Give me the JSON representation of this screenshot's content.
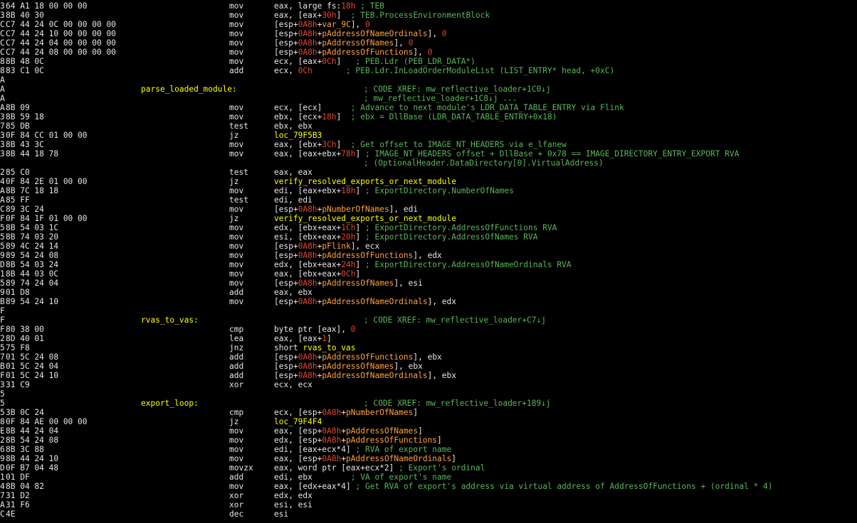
{
  "colors": {
    "background": "#000000",
    "text": "#e6e6e6",
    "number": "#e0472c",
    "variable": "#ffa13d",
    "comment": "#5ab55a",
    "label": "#ffff00"
  },
  "lines": [
    {
      "prefix": "3",
      "bytes": "64 A1 18 00 00 00",
      "mnemonic": "mov",
      "operands": [
        [
          "t",
          "eax, large fs:"
        ],
        [
          "n",
          "18h"
        ],
        [
          "c",
          " ; TEB"
        ]
      ]
    },
    {
      "prefix": "3",
      "bytes": "8B 40 30",
      "mnemonic": "mov",
      "operands": [
        [
          "t",
          "eax, [eax+"
        ],
        [
          "n",
          "30h"
        ],
        [
          "t",
          "]"
        ],
        [
          "c",
          "  ; TEB.ProcessEnvironmentBlock"
        ]
      ]
    },
    {
      "prefix": "C",
      "bytes": "C7 44 24 0C 00 00 00 00",
      "mnemonic": "mov",
      "operands": [
        [
          "t",
          "[esp+"
        ],
        [
          "n",
          "0A8h"
        ],
        [
          "t",
          "+"
        ],
        [
          "v",
          "var_9C"
        ],
        [
          "t",
          "], "
        ],
        [
          "n",
          "0"
        ]
      ]
    },
    {
      "prefix": "C",
      "bytes": "C7 44 24 10 00 00 00 00",
      "mnemonic": "mov",
      "operands": [
        [
          "t",
          "[esp+"
        ],
        [
          "n",
          "0A8h"
        ],
        [
          "t",
          "+"
        ],
        [
          "v",
          "pAddressOfNameOrdinals"
        ],
        [
          "t",
          "], "
        ],
        [
          "n",
          "0"
        ]
      ]
    },
    {
      "prefix": "C",
      "bytes": "C7 44 24 04 00 00 00 00",
      "mnemonic": "mov",
      "operands": [
        [
          "t",
          "[esp+"
        ],
        [
          "n",
          "0A8h"
        ],
        [
          "t",
          "+"
        ],
        [
          "v",
          "pAddressOfNames"
        ],
        [
          "t",
          "], "
        ],
        [
          "n",
          "0"
        ]
      ]
    },
    {
      "prefix": "C",
      "bytes": "C7 44 24 08 00 00 00 00",
      "mnemonic": "mov",
      "operands": [
        [
          "t",
          "[esp+"
        ],
        [
          "n",
          "0A8h"
        ],
        [
          "t",
          "+"
        ],
        [
          "v",
          "pAddressOfFunctions"
        ],
        [
          "t",
          "], "
        ],
        [
          "n",
          "0"
        ]
      ]
    },
    {
      "prefix": "8",
      "bytes": "8B 48 0C",
      "mnemonic": "mov",
      "operands": [
        [
          "t",
          "ecx, [eax+"
        ],
        [
          "n",
          "0Ch"
        ],
        [
          "t",
          "]"
        ],
        [
          "c",
          "   ; PEB.Ldr (PEB_LDR_DATA*)"
        ]
      ]
    },
    {
      "prefix": "8",
      "bytes": "83 C1 0C",
      "mnemonic": "add",
      "operands": [
        [
          "t",
          "ecx, "
        ],
        [
          "n",
          "0Ch"
        ],
        [
          "c",
          "       ; PEB.Ldr.InLoadOrderModuleList (LIST_ENTRY* head, +0xC)"
        ]
      ]
    },
    {
      "prefix": "A"
    },
    {
      "prefix": "A",
      "label": "parse_loaded_module:",
      "xref": "; CODE XREF: mw_reflective_loader+1C0↓j"
    },
    {
      "prefix": "A",
      "xref": "; mw_reflective_loader+1C8↓j ..."
    },
    {
      "prefix": "A",
      "bytes": "8B 09",
      "mnemonic": "mov",
      "operands": [
        [
          "t",
          "ecx, [ecx]"
        ],
        [
          "c",
          "      ; Advance to next module's LDR_DATA_TABLE_ENTRY via Flink"
        ]
      ]
    },
    {
      "prefix": "3",
      "bytes": "8B 59 18",
      "mnemonic": "mov",
      "operands": [
        [
          "t",
          "ebx, [ecx+"
        ],
        [
          "n",
          "18h"
        ],
        [
          "t",
          "]"
        ],
        [
          "c",
          "  ; ebx = DllBase (LDR_DATA_TABLE_ENTRY+0x18)"
        ]
      ]
    },
    {
      "prefix": "7",
      "bytes": "85 DB",
      "mnemonic": "test",
      "operands": [
        [
          "t",
          "ebx, ebx"
        ]
      ]
    },
    {
      "prefix": "3",
      "bytes": "0F 84 CC 01 00 00",
      "mnemonic": "jz",
      "operands": [
        [
          "y",
          "loc_79F5B3"
        ]
      ]
    },
    {
      "prefix": "3",
      "bytes": "8B 43 3C",
      "mnemonic": "mov",
      "operands": [
        [
          "t",
          "eax, [ebx+"
        ],
        [
          "n",
          "3Ch"
        ],
        [
          "t",
          "]"
        ],
        [
          "c",
          "  ; Get offset to IMAGE_NT_HEADERS via e_lfanew"
        ]
      ]
    },
    {
      "prefix": "3",
      "bytes": "8B 44 18 78",
      "mnemonic": "mov",
      "operands": [
        [
          "t",
          "eax, [eax+ebx+"
        ],
        [
          "n",
          "78h"
        ],
        [
          "t",
          "]"
        ],
        [
          "c",
          " ; IMAGE_NT_HEADERS offset + DllBase + 0x78 == IMAGE_DIRECTORY_ENTRY_EXPORT RVA"
        ]
      ]
    },
    {
      "prefix": "",
      "continuation": "; (OptionalHeader.DataDirectory[0].VirtualAddress)"
    },
    {
      "prefix": "2",
      "bytes": "85 C0",
      "mnemonic": "test",
      "operands": [
        [
          "t",
          "eax, eax"
        ]
      ]
    },
    {
      "prefix": "4",
      "bytes": "0F 84 2E 01 00 00",
      "mnemonic": "jz",
      "operands": [
        [
          "y",
          "verify_resolved_exports_or_next_module"
        ]
      ]
    },
    {
      "prefix": "A",
      "bytes": "8B 7C 18 18",
      "mnemonic": "mov",
      "operands": [
        [
          "t",
          "edi, [eax+ebx+"
        ],
        [
          "n",
          "18h"
        ],
        [
          "t",
          "]"
        ],
        [
          "c",
          " ; ExportDirectory.NumberOfNames"
        ]
      ]
    },
    {
      "prefix": "A",
      "bytes": "85 FF",
      "mnemonic": "test",
      "operands": [
        [
          "t",
          "edi, edi"
        ]
      ]
    },
    {
      "prefix": "C",
      "bytes": "89 3C 24",
      "mnemonic": "mov",
      "operands": [
        [
          "t",
          "[esp+"
        ],
        [
          "n",
          "0A8h"
        ],
        [
          "t",
          "+"
        ],
        [
          "v",
          "pNumberOfNames"
        ],
        [
          "t",
          "], edi"
        ]
      ]
    },
    {
      "prefix": "F",
      "bytes": "0F 84 1F 01 00 00",
      "mnemonic": "jz",
      "operands": [
        [
          "y",
          "verify_resolved_exports_or_next_module"
        ]
      ]
    },
    {
      "prefix": "5",
      "bytes": "8B 54 03 1C",
      "mnemonic": "mov",
      "operands": [
        [
          "t",
          "edx, [ebx+eax+"
        ],
        [
          "n",
          "1Ch"
        ],
        [
          "t",
          "]"
        ],
        [
          "c",
          " ; ExportDirectory.AddressOfFunctions RVA"
        ]
      ]
    },
    {
      "prefix": "5",
      "bytes": "8B 74 03 20",
      "mnemonic": "mov",
      "operands": [
        [
          "t",
          "esi, [ebx+eax+"
        ],
        [
          "n",
          "20h"
        ],
        [
          "t",
          "]"
        ],
        [
          "c",
          " ; ExportDirectory.AddressOfNames RVA"
        ]
      ]
    },
    {
      "prefix": "5",
      "bytes": "89 4C 24 14",
      "mnemonic": "mov",
      "operands": [
        [
          "t",
          "[esp+"
        ],
        [
          "n",
          "0A8h"
        ],
        [
          "t",
          "+"
        ],
        [
          "v",
          "pFlink"
        ],
        [
          "t",
          "], ecx"
        ]
      ]
    },
    {
      "prefix": "9",
      "bytes": "89 54 24 08",
      "mnemonic": "mov",
      "operands": [
        [
          "t",
          "[esp+"
        ],
        [
          "n",
          "0A8h"
        ],
        [
          "t",
          "+"
        ],
        [
          "v",
          "pAddressOfFunctions"
        ],
        [
          "t",
          "], edx"
        ]
      ]
    },
    {
      "prefix": "D",
      "bytes": "8B 54 03 24",
      "mnemonic": "mov",
      "operands": [
        [
          "t",
          "edx, [ebx+eax+"
        ],
        [
          "n",
          "24h"
        ],
        [
          "t",
          "]"
        ],
        [
          "c",
          " ; ExportDirectory.AddressOfNameOrdinals RVA"
        ]
      ]
    },
    {
      "prefix": "1",
      "bytes": "8B 44 03 0C",
      "mnemonic": "mov",
      "operands": [
        [
          "t",
          "eax, [ebx+eax+"
        ],
        [
          "n",
          "0Ch"
        ],
        [
          "t",
          "]"
        ]
      ]
    },
    {
      "prefix": "5",
      "bytes": "89 74 24 04",
      "mnemonic": "mov",
      "operands": [
        [
          "t",
          "[esp+"
        ],
        [
          "n",
          "0A8h"
        ],
        [
          "t",
          "+"
        ],
        [
          "v",
          "pAddressOfNames"
        ],
        [
          "t",
          "], esi"
        ]
      ]
    },
    {
      "prefix": "9",
      "bytes": "01 D8",
      "mnemonic": "add",
      "operands": [
        [
          "t",
          "eax, ebx"
        ]
      ]
    },
    {
      "prefix": "B",
      "bytes": "89 54 24 10",
      "mnemonic": "mov",
      "operands": [
        [
          "t",
          "[esp+"
        ],
        [
          "n",
          "0A8h"
        ],
        [
          "t",
          "+"
        ],
        [
          "v",
          "pAddressOfNameOrdinals"
        ],
        [
          "t",
          "], edx"
        ]
      ]
    },
    {
      "prefix": "F"
    },
    {
      "prefix": "F",
      "label": "rvas_to_vas:",
      "xref": "; CODE XREF: mw_reflective_loader+C7↓j"
    },
    {
      "prefix": "F",
      "bytes": "80 38 00",
      "mnemonic": "cmp",
      "operands": [
        [
          "t",
          "byte ptr [eax], "
        ],
        [
          "n",
          "0"
        ]
      ]
    },
    {
      "prefix": "2",
      "bytes": "8D 40 01",
      "mnemonic": "lea",
      "operands": [
        [
          "t",
          "eax, [eax+"
        ],
        [
          "n",
          "1"
        ],
        [
          "t",
          "]"
        ]
      ]
    },
    {
      "prefix": "5",
      "bytes": "75 F8",
      "mnemonic": "jnz",
      "operands": [
        [
          "t",
          "short "
        ],
        [
          "y",
          "rvas_to_vas"
        ]
      ]
    },
    {
      "prefix": "7",
      "bytes": "01 5C 24 08",
      "mnemonic": "add",
      "operands": [
        [
          "t",
          "[esp+"
        ],
        [
          "n",
          "0A8h"
        ],
        [
          "t",
          "+"
        ],
        [
          "v",
          "pAddressOfFunctions"
        ],
        [
          "t",
          "], ebx"
        ]
      ]
    },
    {
      "prefix": "B",
      "bytes": "01 5C 24 04",
      "mnemonic": "add",
      "operands": [
        [
          "t",
          "[esp+"
        ],
        [
          "n",
          "0A8h"
        ],
        [
          "t",
          "+"
        ],
        [
          "v",
          "pAddressOfNames"
        ],
        [
          "t",
          "], ebx"
        ]
      ]
    },
    {
      "prefix": "F",
      "bytes": "01 5C 24 10",
      "mnemonic": "add",
      "operands": [
        [
          "t",
          "[esp+"
        ],
        [
          "n",
          "0A8h"
        ],
        [
          "t",
          "+"
        ],
        [
          "v",
          "pAddressOfNameOrdinals"
        ],
        [
          "t",
          "], ebx"
        ]
      ]
    },
    {
      "prefix": "3",
      "bytes": "31 C9",
      "mnemonic": "xor",
      "operands": [
        [
          "t",
          "ecx, ecx"
        ]
      ]
    },
    {
      "prefix": "5"
    },
    {
      "prefix": "5",
      "label": "export_loop:",
      "xref": "; CODE XREF: mw_reflective_loader+189↓j"
    },
    {
      "prefix": "5",
      "bytes": "3B 0C 24",
      "mnemonic": "cmp",
      "operands": [
        [
          "t",
          "ecx, [esp+"
        ],
        [
          "n",
          "0A8h"
        ],
        [
          "t",
          "+"
        ],
        [
          "v",
          "pNumberOfNames"
        ],
        [
          "t",
          "]"
        ]
      ]
    },
    {
      "prefix": "8",
      "bytes": "0F 84 AE 00 00 00",
      "mnemonic": "jz",
      "operands": [
        [
          "y",
          "loc_79F4F4"
        ]
      ]
    },
    {
      "prefix": "E",
      "bytes": "8B 44 24 04",
      "mnemonic": "mov",
      "operands": [
        [
          "t",
          "eax, [esp+"
        ],
        [
          "n",
          "0A8h"
        ],
        [
          "t",
          "+"
        ],
        [
          "v",
          "pAddressOfNames"
        ],
        [
          "t",
          "]"
        ]
      ]
    },
    {
      "prefix": "2",
      "bytes": "8B 54 24 08",
      "mnemonic": "mov",
      "operands": [
        [
          "t",
          "edx, [esp+"
        ],
        [
          "n",
          "0A8h"
        ],
        [
          "t",
          "+"
        ],
        [
          "v",
          "pAddressOfFunctions"
        ],
        [
          "t",
          "]"
        ]
      ]
    },
    {
      "prefix": "6",
      "bytes": "8B 3C 88",
      "mnemonic": "mov",
      "operands": [
        [
          "t",
          "edi, [eax+ecx*4]"
        ],
        [
          "c",
          " ; RVA of export name"
        ]
      ]
    },
    {
      "prefix": "9",
      "bytes": "8B 44 24 10",
      "mnemonic": "mov",
      "operands": [
        [
          "t",
          "eax, [esp+"
        ],
        [
          "n",
          "0A8h"
        ],
        [
          "t",
          "+"
        ],
        [
          "v",
          "pAddressOfNameOrdinals"
        ],
        [
          "t",
          "]"
        ]
      ]
    },
    {
      "prefix": "D",
      "bytes": "0F B7 04 48",
      "mnemonic": "movzx",
      "operands": [
        [
          "t",
          "eax, word ptr [eax+ecx*2]"
        ],
        [
          "c",
          " ; Export's ordinal"
        ]
      ]
    },
    {
      "prefix": "1",
      "bytes": "01 DF",
      "mnemonic": "add",
      "operands": [
        [
          "t",
          "edi, ebx"
        ],
        [
          "c",
          "        ; VA of export's name"
        ]
      ]
    },
    {
      "prefix": "4",
      "bytes": "8B 04 82",
      "mnemonic": "mov",
      "operands": [
        [
          "t",
          "eax, [edx+eax*4]"
        ],
        [
          "c",
          " ; Get RVA of export's address via virtual address of AddressOfFunctions + (ordinal * 4)"
        ]
      ]
    },
    {
      "prefix": "7",
      "bytes": "31 D2",
      "mnemonic": "xor",
      "operands": [
        [
          "t",
          "edx, edx"
        ]
      ]
    },
    {
      "prefix": "A",
      "bytes": "31 F6",
      "mnemonic": "xor",
      "operands": [
        [
          "t",
          "esi, esi"
        ]
      ]
    },
    {
      "prefix": "C",
      "bytes": "4E",
      "mnemonic": "dec",
      "operands": [
        [
          "t",
          "esi"
        ]
      ]
    }
  ]
}
